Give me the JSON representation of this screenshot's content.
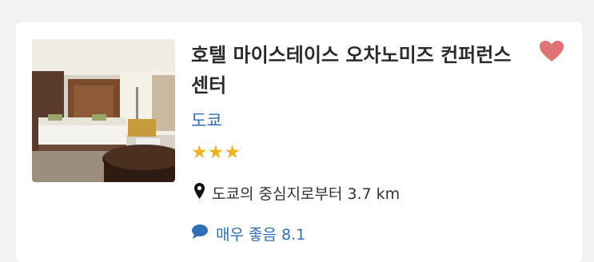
{
  "hotel": {
    "name": "호텔 마이스테이스 오차노미즈 컨퍼런스 센터",
    "location_link": "도쿄",
    "stars": "★★★",
    "star_rating": 3,
    "distance_text": "도쿄의 중심지로부터 3.7 km",
    "review_text": "매우 좋음 8.1",
    "favorite_saved": true
  },
  "colors": {
    "background": "#f2f2f2",
    "card": "#ffffff",
    "title_text": "#2b2b2b",
    "link_blue": "#2f6fb5",
    "star_gold": "#efb224",
    "heart": "#e07373"
  },
  "icons": {
    "favorite": "heart-icon",
    "distance": "map-pin-icon",
    "review": "speech-bubble-icon"
  }
}
